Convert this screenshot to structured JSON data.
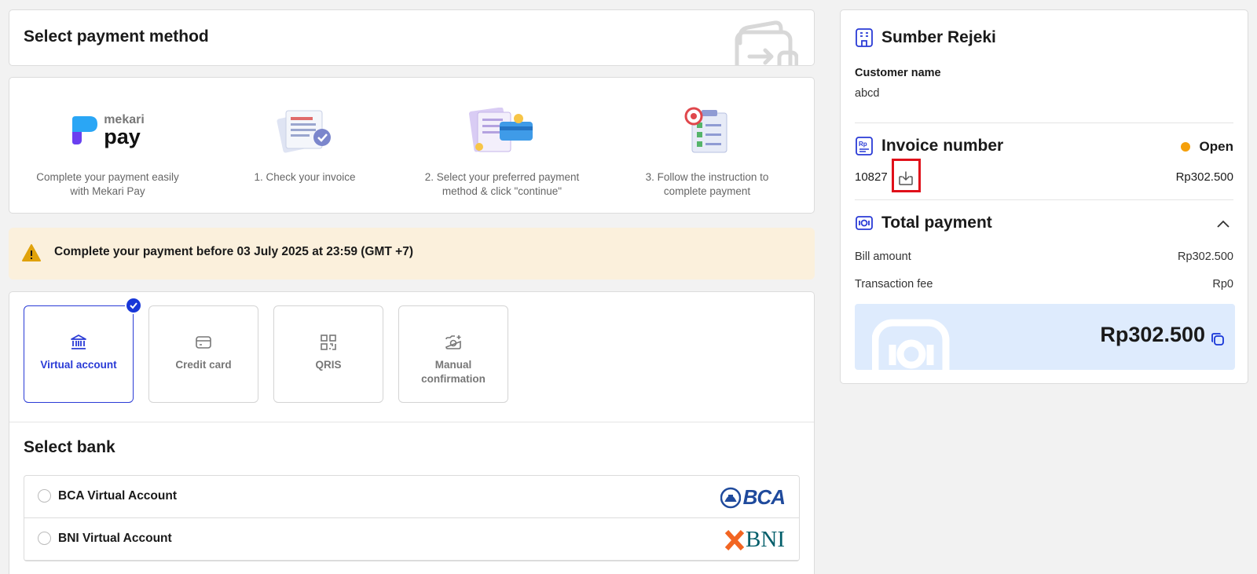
{
  "header": {
    "title": "Select payment method"
  },
  "steps": [
    {
      "brand_top": "mekari",
      "brand_bottom": "pay",
      "text": "Complete your payment easily with Mekari Pay"
    },
    {
      "text": "1. Check your invoice"
    },
    {
      "text": "2. Select your preferred payment method & click \"continue\""
    },
    {
      "text": "3. Follow the instruction to complete payment"
    }
  ],
  "alert": {
    "text": "Complete your payment before 03 July 2025 at 23:59 (GMT +7)"
  },
  "methods": [
    {
      "label": "Virtual account",
      "icon": "bank-icon",
      "selected": true
    },
    {
      "label": "Credit card",
      "icon": "credit-card-icon",
      "selected": false
    },
    {
      "label": "QRIS",
      "icon": "qr-code-icon",
      "selected": false
    },
    {
      "label": "Manual confirmation",
      "icon": "camera-icon",
      "selected": false
    }
  ],
  "bank_section": {
    "title": "Select bank"
  },
  "banks": [
    {
      "name": "BCA Virtual Account",
      "logo": "BCA"
    },
    {
      "name": "BNI Virtual Account",
      "logo": "BNI"
    }
  ],
  "merchant": {
    "name": "Sumber Rejeki",
    "customer_label": "Customer name",
    "customer_value": "abcd"
  },
  "invoice": {
    "title": "Invoice number",
    "status": "Open",
    "number": "10827",
    "amount": "Rp302.500"
  },
  "total": {
    "title": "Total payment",
    "bill_label": "Bill amount",
    "bill_value": "Rp302.500",
    "fee_label": "Transaction fee",
    "fee_value": "Rp0",
    "amount": "Rp302.500"
  },
  "colors": {
    "accent": "#1736d8",
    "status_open": "#f5a00b",
    "alert_bg": "#fbf0dc",
    "total_bg": "#deebfd",
    "highlight": "#e0101a"
  }
}
